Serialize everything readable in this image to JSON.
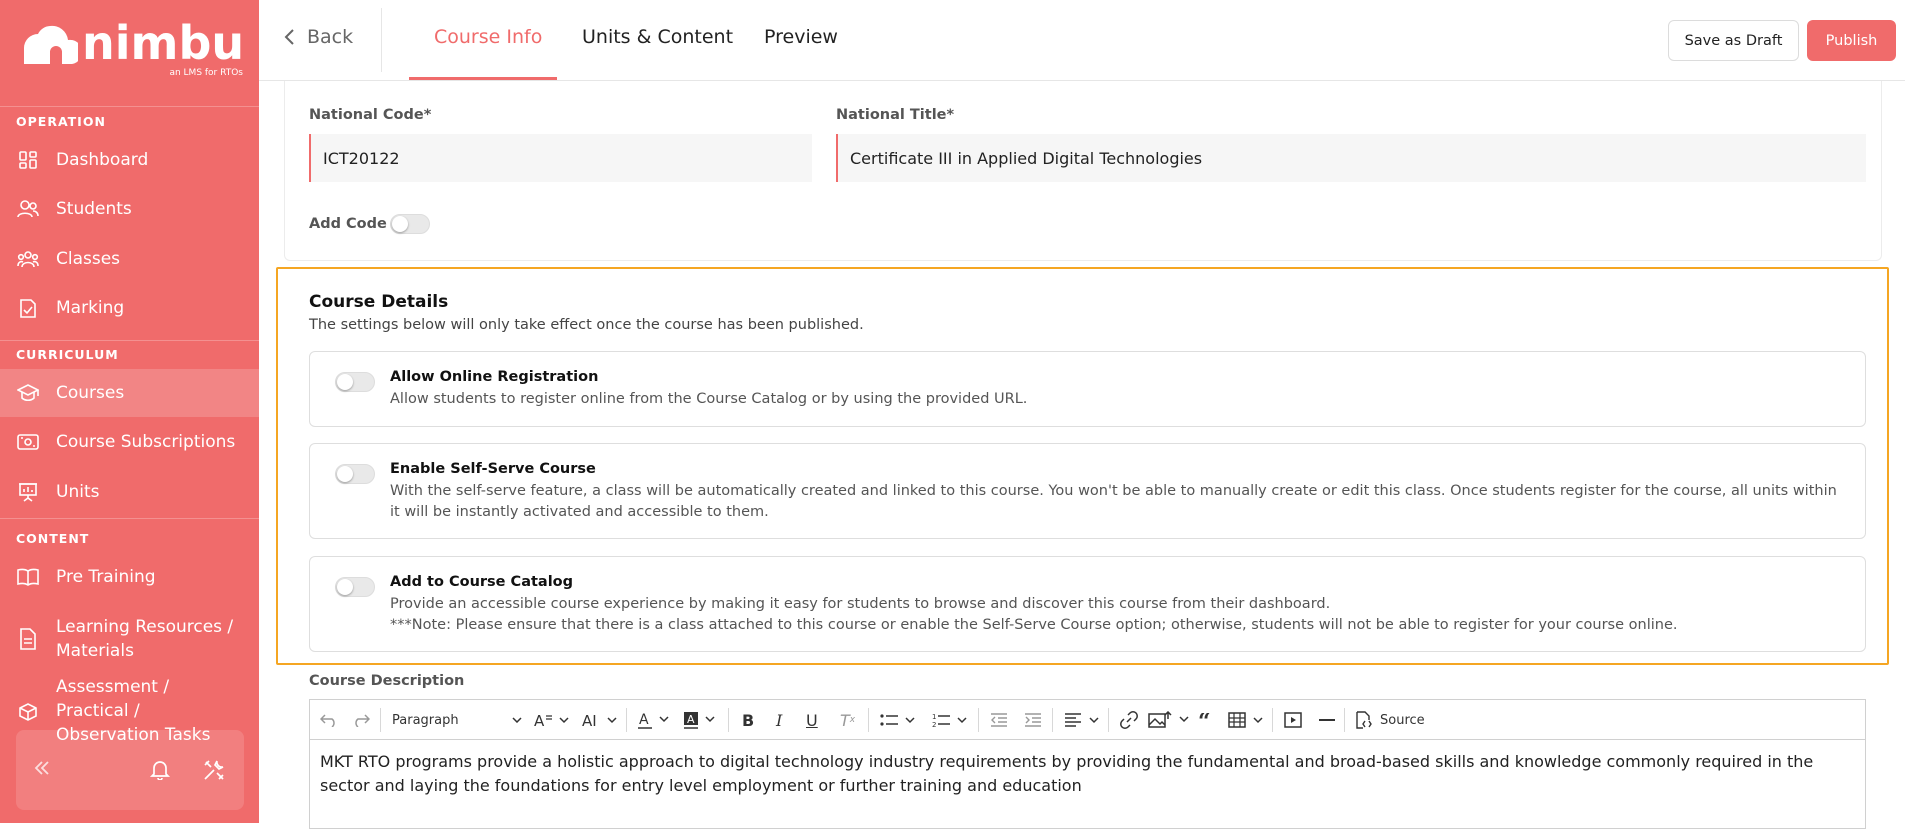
{
  "brand": {
    "name": "nimbu",
    "tagline": "an LMS for RTOs"
  },
  "sidebar": {
    "sections": [
      {
        "label": "OPERATION"
      },
      {
        "label": "CURRICULUM"
      },
      {
        "label": "CONTENT"
      }
    ],
    "items": [
      {
        "label": "Dashboard",
        "icon": "grid-icon"
      },
      {
        "label": "Students",
        "icon": "users-icon"
      },
      {
        "label": "Classes",
        "icon": "group-icon"
      },
      {
        "label": "Marking",
        "icon": "clipboard-check-icon"
      },
      {
        "label": "Courses",
        "icon": "graduation-cap-icon",
        "active": true
      },
      {
        "label": "Course Subscriptions",
        "icon": "subscription-icon"
      },
      {
        "label": "Units",
        "icon": "presentation-board-icon"
      },
      {
        "label": "Pre Training",
        "icon": "book-open-icon"
      },
      {
        "label": "Learning Resources / Materials",
        "icon": "document-icon"
      },
      {
        "label": "Assessment / Practical / Observation Tasks",
        "icon": "box-icon"
      }
    ],
    "footer": {
      "collapse_icon": "double-chevron-left-icon",
      "notifications_icon": "bell-icon",
      "tools_icon": "tools-icon"
    }
  },
  "topbar": {
    "back_label": "Back",
    "tabs": [
      {
        "label": "Course Info",
        "active": true
      },
      {
        "label": "Units & Content"
      },
      {
        "label": "Preview"
      }
    ],
    "save_draft_label": "Save as Draft",
    "publish_label": "Publish"
  },
  "form": {
    "national_code_label": "National Code*",
    "national_code_value": "ICT20122",
    "national_title_label": "National Title*",
    "national_title_value": "Certificate III in Applied Digital Technologies",
    "add_code_label": "Add Code",
    "add_code_on": false
  },
  "course_details": {
    "title": "Course Details",
    "subtitle": "The settings below will only take effect once the course has been published.",
    "options": [
      {
        "title": "Allow Online Registration",
        "desc": "Allow students to register online from the Course Catalog or by using the provided URL.",
        "on": false
      },
      {
        "title": "Enable Self-Serve Course",
        "desc": "With the self-serve feature, a class will be automatically created and linked to this course. You won't be able to manually create or edit this class. Once students register for the course, all units within it will be instantly activated and accessible to them.",
        "on": false
      },
      {
        "title": "Add to Course Catalog",
        "desc": "Provide an accessible course experience by making it easy for students to browse and discover this course from their dashboard.",
        "note": "***Note: Please ensure that there is a class attached to this course or enable the Self-Serve Course option; otherwise, students will not be able to register for your course online.",
        "on": false
      }
    ]
  },
  "description": {
    "label": "Course Description",
    "paragraph_style": "Paragraph",
    "source_label": "Source",
    "body": "MKT RTO programs provide a holistic approach to digital technology industry requirements by providing the fundamental and broad-based skills and knowledge commonly required in the sector and laying the foundations for entry level employment or further training and education"
  },
  "colors": {
    "brand": "#f06b6b",
    "highlight": "#f5a623"
  }
}
